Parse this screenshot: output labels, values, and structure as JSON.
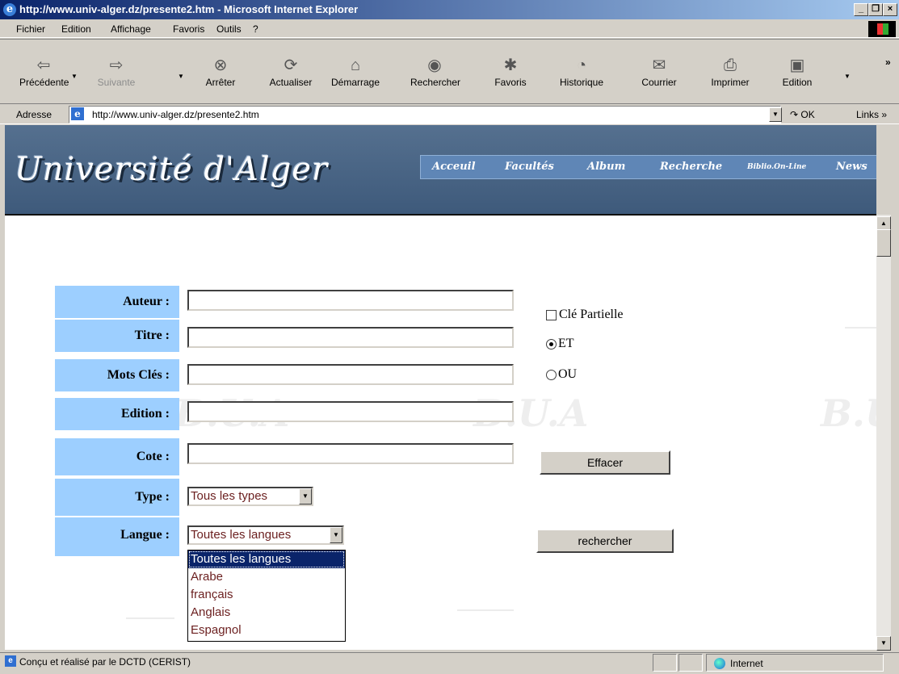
{
  "window": {
    "title": "http://www.univ-alger.dz/presente2.htm - Microsoft Internet Explorer",
    "minimize": "_",
    "maximize": "❐",
    "close": "×"
  },
  "menu": [
    "Fichier",
    "Edition",
    "Affichage",
    "Favoris",
    "Outils",
    "?"
  ],
  "toolbar": {
    "back": "Précédente",
    "forward": "Suivante",
    "stop": "Arrêter",
    "refresh": "Actualiser",
    "home": "Démarrage",
    "search": "Rechercher",
    "favorites": "Favoris",
    "history": "Historique",
    "mail": "Courrier",
    "print": "Imprimer",
    "edit": "Edition",
    "more": "»"
  },
  "address": {
    "label": "Adresse",
    "url": "http://www.univ-alger.dz/presente2.htm",
    "go": "OK",
    "links": "Links »"
  },
  "site": {
    "logo": "Université d'Alger",
    "nav": [
      "Acceuil",
      "Facultés",
      "Album",
      "Recherche",
      "Biblio.On-Line",
      "News"
    ],
    "watermark": "B.U.A"
  },
  "form": {
    "labels": {
      "author": "Auteur :",
      "title": "Titre :",
      "keywords": "Mots Clés :",
      "edition": "Edition :",
      "cote": "Cote :",
      "type": "Type :",
      "language": "Langue :"
    },
    "values": {
      "author": "",
      "title": "",
      "keywords": "",
      "edition": "",
      "cote": ""
    },
    "partial_key": "Clé Partielle",
    "and": "ET",
    "or": "OU",
    "type_selected": "Tous les types",
    "language_selected": "Toutes les langues",
    "language_options": [
      "Toutes les langues",
      "Arabe",
      "français",
      "Anglais",
      "Espagnol"
    ],
    "clear_button": "Effacer",
    "search_button": "rechercher"
  },
  "status": {
    "text": "Conçu et réalisé par le DCTD (CERIST)",
    "zone": "Internet"
  }
}
